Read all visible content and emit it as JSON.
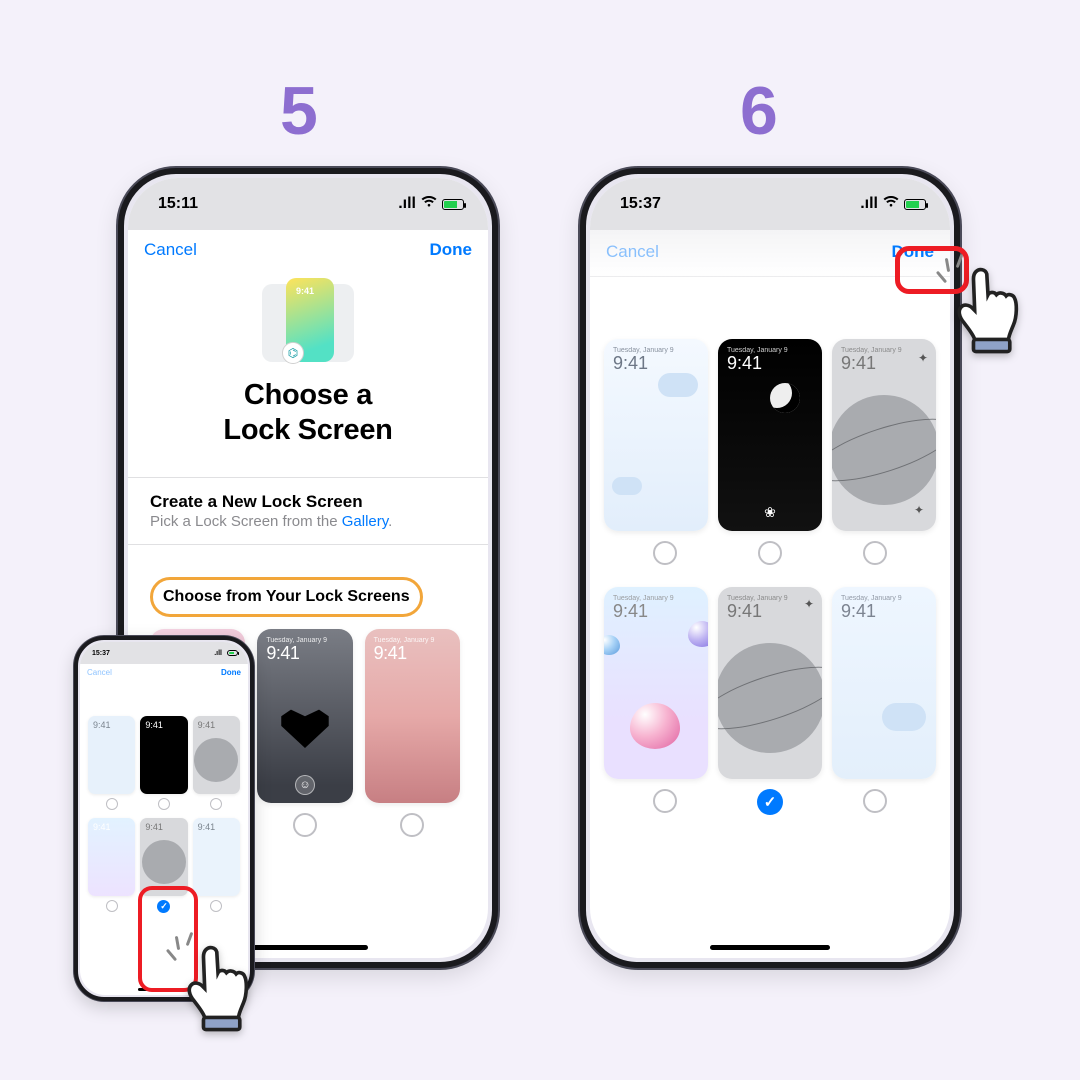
{
  "steps": {
    "five": "5",
    "six": "6"
  },
  "status": {
    "time_left": "15:11",
    "time_right": "15:37",
    "time_small": "15:37",
    "signal": ".ıll",
    "wifi": "✦"
  },
  "nav": {
    "cancel": "Cancel",
    "done": "Done"
  },
  "hero": {
    "card_time": "9:41",
    "title_line": "Choose a\nLock Screen"
  },
  "create": {
    "title": "Create a New Lock Screen",
    "sub_prefix": "Pick a Lock Screen from the ",
    "gallery": "Gallery",
    "sub_suffix": "."
  },
  "choose_label": "Choose from Your Lock Screens",
  "preview": {
    "date": "Tuesday, January 9",
    "time": "9:41"
  },
  "icons": {
    "check": "✓",
    "bike": "⌬",
    "emoji": "☺",
    "paw": "❀"
  }
}
